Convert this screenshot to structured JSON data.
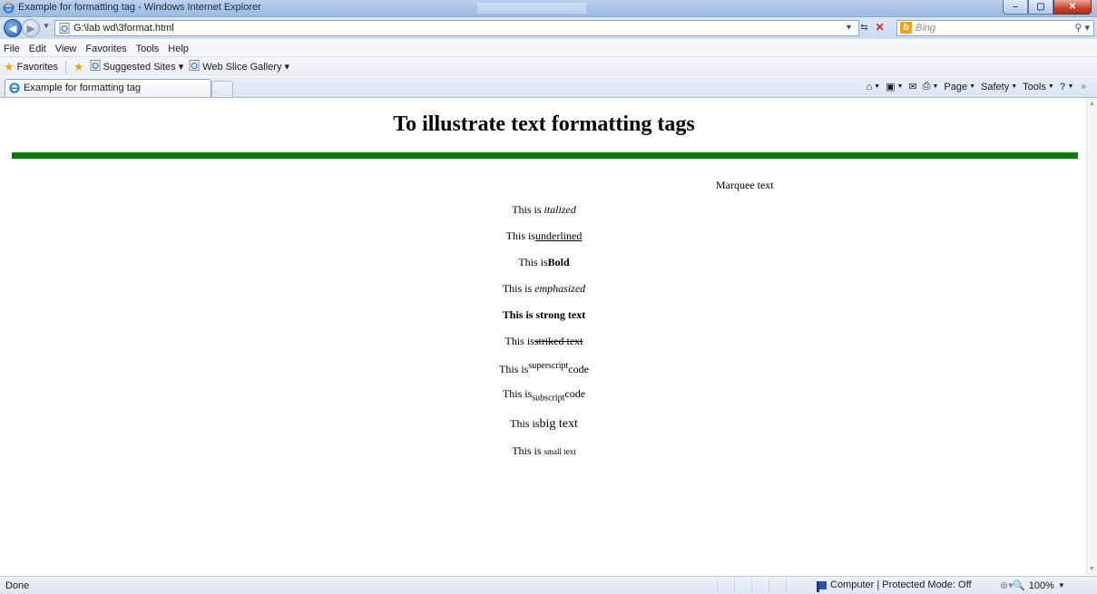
{
  "window": {
    "title": "Example for formatting tag - Windows Internet Explorer",
    "controls": {
      "minimize": "–",
      "maximize": "▢",
      "close": "✕"
    }
  },
  "address_bar": {
    "url": "G:\\lab wd\\3format.html"
  },
  "search": {
    "placeholder": "Bing"
  },
  "menu": [
    "File",
    "Edit",
    "View",
    "Favorites",
    "Tools",
    "Help"
  ],
  "favorites_bar": {
    "favorites_label": "Favorites",
    "items": [
      "Suggested Sites ▾",
      "Web Slice Gallery ▾"
    ]
  },
  "tab": {
    "label": "Example for formatting tag"
  },
  "command_bar": {
    "page": "Page",
    "safety": "Safety",
    "tools": "Tools"
  },
  "content": {
    "heading": "To illustrate text formatting tags",
    "marquee": "Marquee text",
    "lines": {
      "italic": {
        "prefix": "This is ",
        "text": "italized"
      },
      "underline": {
        "prefix": "This is",
        "text": "underlined"
      },
      "bold": {
        "prefix": "This is",
        "text": "Bold"
      },
      "emphasis": {
        "prefix": "This is ",
        "text": "emphasized"
      },
      "strong": {
        "prefix": "This is ",
        "text": "strong text"
      },
      "strike": {
        "prefix": "This is",
        "text": "striked text"
      },
      "superscript": {
        "prefix": "This is",
        "sup": "superscript",
        "suffix": "code"
      },
      "subscript": {
        "prefix": "This is",
        "sub": "subscript",
        "suffix": "code"
      },
      "big": {
        "prefix": "This is",
        "text": "big text"
      },
      "small": {
        "prefix": "This is ",
        "text": "small text"
      }
    },
    "colors": {
      "rule": "#007e00"
    }
  },
  "status_bar": {
    "status": "Done",
    "zone": "Computer | Protected Mode: Off",
    "zoom": "100%"
  }
}
